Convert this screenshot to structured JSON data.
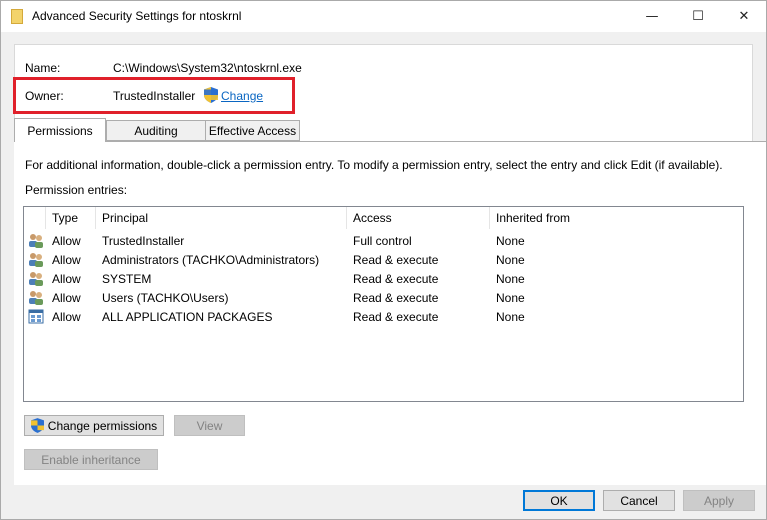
{
  "window": {
    "title": "Advanced Security Settings for ntoskrnl",
    "minimize": "—",
    "maximize": "☐",
    "close": "✕"
  },
  "name_row": {
    "label": "Name:",
    "value": "C:\\Windows\\System32\\ntoskrnl.exe"
  },
  "owner_row": {
    "label": "Owner:",
    "value": "TrustedInstaller",
    "change_link": "Change"
  },
  "tabs": [
    {
      "label": "Permissions",
      "active": true
    },
    {
      "label": "Auditing",
      "active": false
    },
    {
      "label": "Effective Access",
      "active": false
    }
  ],
  "info_text": "For additional information, double-click a permission entry. To modify a permission entry, select the entry and click Edit (if available).",
  "entries_label": "Permission entries:",
  "table": {
    "columns": [
      "Type",
      "Principal",
      "Access",
      "Inherited from"
    ],
    "rows": [
      {
        "icon": "users-icon",
        "type": "Allow",
        "principal": "TrustedInstaller",
        "access": "Full control",
        "inherited": "None"
      },
      {
        "icon": "users-icon",
        "type": "Allow",
        "principal": "Administrators (TACHKO\\Administrators)",
        "access": "Read & execute",
        "inherited": "None"
      },
      {
        "icon": "users-icon",
        "type": "Allow",
        "principal": "SYSTEM",
        "access": "Read & execute",
        "inherited": "None"
      },
      {
        "icon": "users-icon",
        "type": "Allow",
        "principal": "Users (TACHKO\\Users)",
        "access": "Read & execute",
        "inherited": "None"
      },
      {
        "icon": "app-packages-icon",
        "type": "Allow",
        "principal": "ALL APPLICATION PACKAGES",
        "access": "Read & execute",
        "inherited": "None"
      }
    ]
  },
  "buttons": {
    "change_permissions": "Change permissions",
    "view": "View",
    "enable_inheritance": "Enable inheritance",
    "ok": "OK",
    "cancel": "Cancel",
    "apply": "Apply"
  },
  "colors": {
    "highlight_box": "#e0202a",
    "link": "#0a66c2",
    "default_button_border": "#0078d7"
  }
}
